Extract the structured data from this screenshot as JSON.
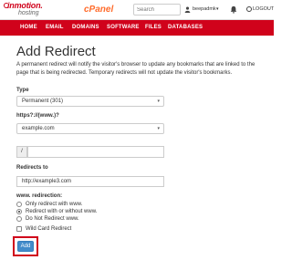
{
  "brand": {
    "logo_main": "inmotion.",
    "logo_sub": "hosting",
    "cpanel": "cPanel"
  },
  "header": {
    "search_placeholder": "Search",
    "username": "beepadmk",
    "logout": "LOGOUT"
  },
  "nav": {
    "items": [
      "HOME",
      "EMAIL",
      "DOMAINS",
      "SOFTWARE",
      "FILES",
      "DATABASES"
    ]
  },
  "page": {
    "title": "Add Redirect",
    "description": "A permanent redirect will notify the visitor's browser to update any bookmarks that are linked to the page that is being redirected. Temporary redirects will not update the visitor's bookmarks."
  },
  "form": {
    "type_label": "Type",
    "type_value": "Permanent (301)",
    "domain_label": "https?://(www.)?",
    "domain_value": "example.com",
    "path_prefix": "/",
    "path_value": "",
    "redirects_to_label": "Redirects to",
    "redirects_to_value": "http://example3.com",
    "www_label": "www. redirection:",
    "www_options": [
      "Only redirect with www.",
      "Redirect with or without www.",
      "Do Not Redirect www."
    ],
    "www_selected": "Redirect with or without www.",
    "wildcard_label": "Wild Card Redirect",
    "wildcard_checked": false,
    "add_label": "Add"
  },
  "colors": {
    "brand_red": "#d0021b",
    "cpanel_orange": "#ff6c2c",
    "button_blue": "#428bca"
  }
}
